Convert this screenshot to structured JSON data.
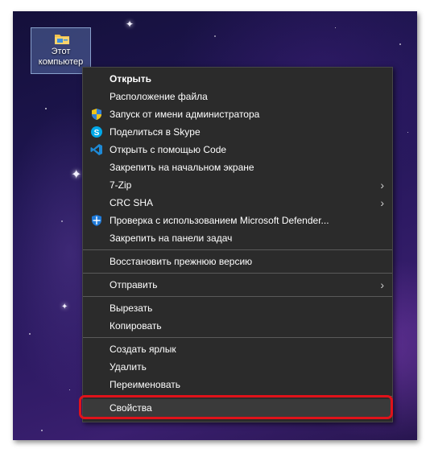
{
  "desktop": {
    "icon_label_line1": "Этот",
    "icon_label_line2": "компьютер",
    "icon": "folder-computer-icon"
  },
  "menu": {
    "items": [
      {
        "label": "Открыть",
        "bold": true
      },
      {
        "label": "Расположение файла"
      },
      {
        "label": "Запуск от имени администратора",
        "icon": "shield-icon"
      },
      {
        "label": "Поделиться в Skype",
        "icon": "skype-icon"
      },
      {
        "label": "Открыть с помощью Code",
        "icon": "vscode-icon"
      },
      {
        "label": "Закрепить на начальном экране"
      },
      {
        "label": "7-Zip",
        "submenu": true
      },
      {
        "label": "CRC SHA",
        "submenu": true
      },
      {
        "label": "Проверка с использованием Microsoft Defender...",
        "icon": "defender-icon"
      },
      {
        "label": "Закрепить на панели задач"
      },
      {
        "label": "Восстановить прежнюю версию"
      },
      {
        "label": "Отправить",
        "submenu": true
      },
      {
        "label": "Вырезать"
      },
      {
        "label": "Копировать"
      },
      {
        "label": "Создать ярлык"
      },
      {
        "label": "Удалить"
      },
      {
        "label": "Переименовать"
      },
      {
        "label": "Свойства",
        "highlighted": true
      }
    ],
    "submenu_arrow": "›"
  },
  "colors": {
    "menu_bg": "#2b2b2b",
    "highlight_outline": "#e0121a",
    "skype": "#00a8e8",
    "vscode": "#1e8ad6",
    "defender": "#1f7ad8"
  }
}
